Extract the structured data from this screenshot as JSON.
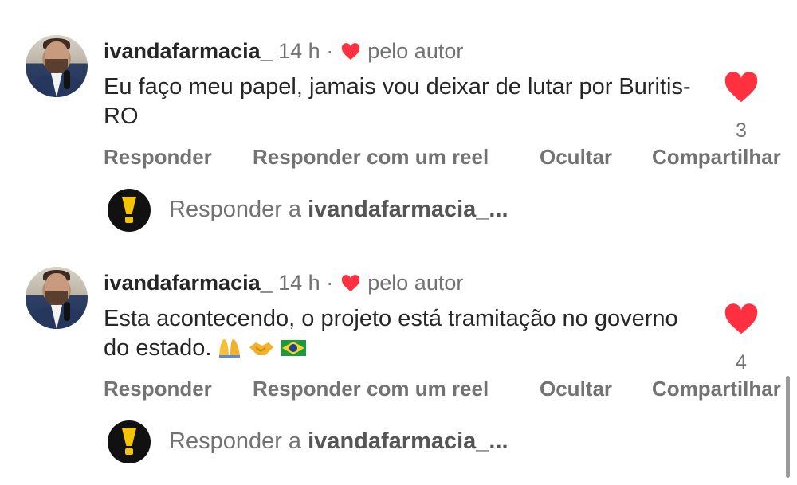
{
  "comments": [
    {
      "username": "ivandafarmacia_",
      "time": "14 h",
      "dot": "·",
      "liked_by_author_label": "pelo autor",
      "text": "Eu faço meu papel,  jamais vou deixar de lutar por Buritis-RO",
      "like_count": "3",
      "actions": {
        "reply": "Responder",
        "reply_reel": "Responder com um reel",
        "hide": "Ocultar",
        "share": "Compartilhar"
      },
      "reply_prompt": "Responder a",
      "reply_target": "ivandafarmacia_..."
    },
    {
      "username": "ivandafarmacia_",
      "time": "14 h",
      "dot": "·",
      "liked_by_author_label": "pelo autor",
      "text": "Esta acontecendo, o projeto está tramitação no governo do estado.",
      "emojis": [
        "folded-hands",
        "handshake",
        "brazil-flag"
      ],
      "like_count": "4",
      "actions": {
        "reply": "Responder",
        "reply_reel": "Responder com um reel",
        "hide": "Ocultar",
        "share": "Compartilhar"
      },
      "reply_prompt": "Responder a",
      "reply_target": "ivandafarmacia_..."
    }
  ],
  "colors": {
    "heart": "#ff3040",
    "muted": "#737373",
    "text": "#262626",
    "reply_icon_bg": "#111111",
    "reply_icon_fg": "#f5c400"
  }
}
